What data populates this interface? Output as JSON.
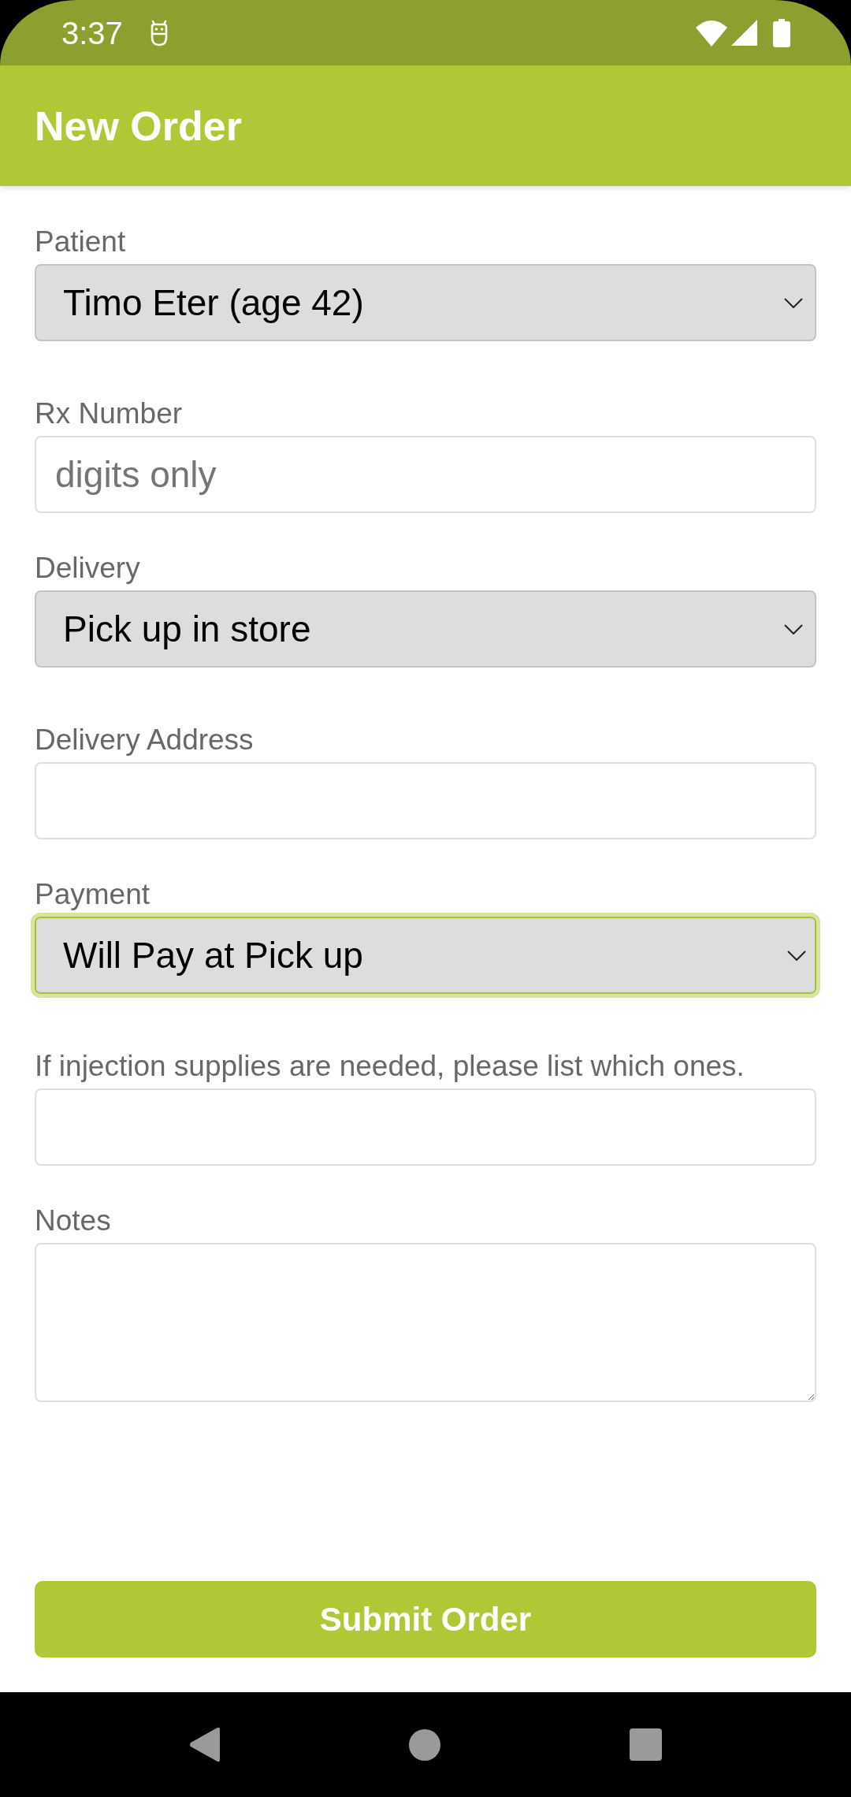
{
  "status_bar": {
    "time": "3:37"
  },
  "app_bar": {
    "title": "New Order"
  },
  "form": {
    "fields": [
      {
        "kind": "select",
        "label": "Patient",
        "value": "Timo Eter (age 42)",
        "focused": false
      },
      {
        "kind": "text",
        "label": "Rx Number",
        "placeholder": "digits only",
        "focused": false
      },
      {
        "kind": "select",
        "label": "Delivery",
        "value": "Pick up in store",
        "focused": false
      },
      {
        "kind": "text",
        "label": "Delivery Address",
        "focused": false
      },
      {
        "kind": "select",
        "label": "Payment",
        "value": "Will Pay at Pick up",
        "focused": true
      },
      {
        "kind": "text",
        "label": "If injection supplies are needed, please list which ones.",
        "focused": false
      },
      {
        "kind": "textarea",
        "label": "Notes",
        "focused": false
      }
    ]
  },
  "submit_button": {
    "label": "Submit Order"
  }
}
